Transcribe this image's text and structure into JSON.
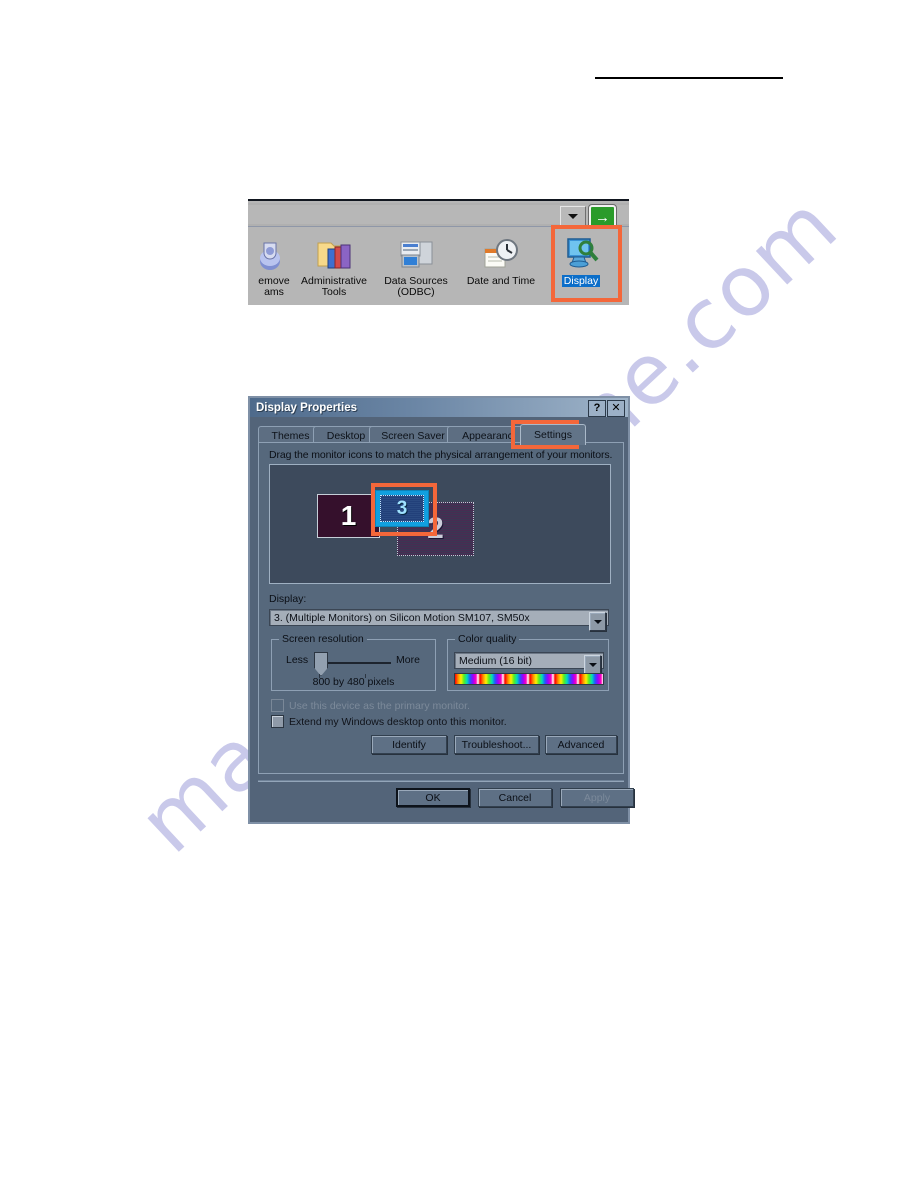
{
  "page": {
    "rule": ""
  },
  "watermark": {
    "text": "manualmachine.com"
  },
  "control_panel": {
    "address_placeholder": "",
    "address_value": "",
    "go_label": "→",
    "combo_icon": "chevron-down-icon",
    "items": [
      {
        "caption": "emove\nams",
        "icon": "add-remove-programs-icon"
      },
      {
        "caption": "Administrative\nTools",
        "icon": "administrative-tools-icon"
      },
      {
        "caption": "Data Sources\n(ODBC)",
        "icon": "data-sources-odbc-icon"
      },
      {
        "caption": "Date and Time",
        "icon": "date-and-time-icon"
      },
      {
        "caption": "Display",
        "icon": "display-icon"
      }
    ],
    "highlight_color": "#f4673a",
    "selection_color": "#0b6ec9"
  },
  "dialog": {
    "title": "Display Properties",
    "help_button": "?",
    "close_button": "✕",
    "tabs": [
      {
        "label": "Themes",
        "active": false
      },
      {
        "label": "Desktop",
        "active": false
      },
      {
        "label": "Screen Saver",
        "active": false
      },
      {
        "label": "Appearanc",
        "active": false
      },
      {
        "label": "Settings",
        "active": true
      }
    ],
    "settings": {
      "hint": "Drag the monitor icons to match the physical arrangement of your monitors.",
      "monitors": [
        {
          "number": "1",
          "state": "normal"
        },
        {
          "number": "2",
          "state": "dimmed"
        },
        {
          "number": "3",
          "state": "selected"
        }
      ],
      "display_label": "Display:",
      "display_value": "3. (Multiple Monitors) on Silicon Motion SM107, SM50x",
      "screen_resolution": {
        "group_title": "Screen resolution",
        "less_label": "Less",
        "more_label": "More",
        "value": "800 by 480 pixels"
      },
      "color_quality": {
        "group_title": "Color quality",
        "value": "Medium (16 bit)"
      },
      "checkboxes": [
        {
          "label": "Use this device as the primary monitor.",
          "checked": false,
          "disabled": true
        },
        {
          "label": "Extend my Windows desktop onto this monitor.",
          "checked": false,
          "disabled": false
        }
      ],
      "buttons": [
        {
          "label": "Identify",
          "disabled": false
        },
        {
          "label": "Troubleshoot...",
          "disabled": false
        },
        {
          "label": "Advanced",
          "disabled": false
        }
      ]
    },
    "footer_buttons": [
      {
        "label": "OK",
        "disabled": false,
        "default": true
      },
      {
        "label": "Cancel",
        "disabled": false,
        "default": false
      },
      {
        "label": "Apply",
        "disabled": true,
        "default": false
      }
    ]
  }
}
